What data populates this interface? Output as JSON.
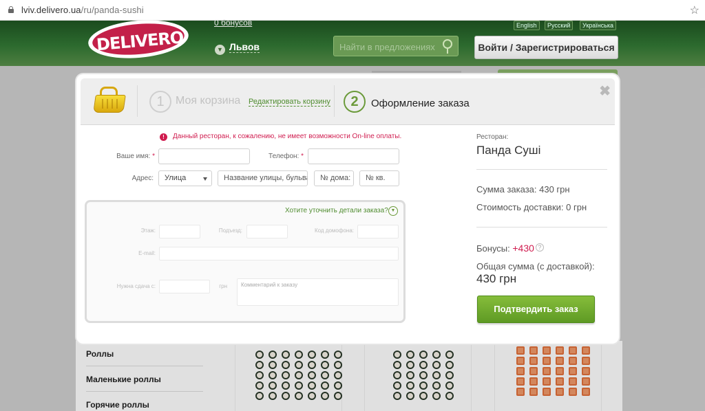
{
  "browser": {
    "url_host": "lviv.delivero.ua",
    "url_path": "/ru/panda-sushi"
  },
  "header": {
    "logo_text": "DELIVERO",
    "bonuses": "0 бонусов",
    "city": "Львов",
    "search_placeholder": "Найти в предложениях",
    "login_button": "Войти / Зарегистрироваться",
    "languages": [
      "English",
      "Русский",
      "Українська"
    ]
  },
  "modal": {
    "step1_number": "1",
    "step1_label": "Моя корзина",
    "edit_cart_link": "Редактировать корзину",
    "step2_number": "2",
    "step2_label": "Оформление заказа",
    "close": "✖",
    "warning": "Данный ресторан, к сожалению, не имеет возможности On-line оплаты.",
    "form": {
      "name_label": "Ваше имя:",
      "phone_label": "Телефон:",
      "address_label": "Адрес:",
      "address_type": "Улица",
      "street_placeholder": "Название улицы, бульвара",
      "house_placeholder": "№ дома:",
      "apt_placeholder": "№ кв.",
      "details_link": "Хотите уточнить детали заказа?",
      "details": {
        "floor_label": "Этаж:",
        "entrance_label": "Подъезд:",
        "intercom_label": "Код домофона:",
        "email_label": "E-mail:",
        "change_label": "Нужна сдача с:",
        "currency": "грн",
        "comment_placeholder": "Комментарий к заказу"
      }
    },
    "summary": {
      "restaurant_label": "Ресторан:",
      "restaurant_name": "Панда Суші",
      "order_sum": "Сумма заказа: 430 грн",
      "delivery_cost": "Стоимость доставки: 0 грн",
      "bonuses_label": "Бонусы: ",
      "bonuses_value": "+430",
      "total_label": "Общая сумма (с доставкой):",
      "total_value": "430 грн",
      "confirm_button": "Подтвердить заказ"
    }
  },
  "background": {
    "categories": [
      "Роллы",
      "Маленькие роллы",
      "Горячие роллы"
    ]
  }
}
